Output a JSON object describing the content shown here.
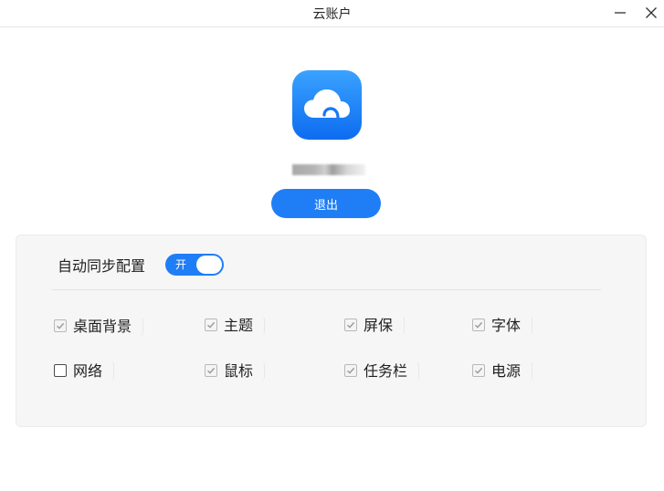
{
  "window": {
    "title": "云账户",
    "minimize_icon": "minimize-icon",
    "close_icon": "close-icon"
  },
  "account": {
    "app_icon": "cloud-icon",
    "name": "",
    "logout_label": "退出"
  },
  "sync": {
    "label": "自动同步配置",
    "toggle_text": "开",
    "enabled": true,
    "accent_color": "#1f7ef6"
  },
  "options": [
    {
      "label": "桌面背景",
      "checked": true
    },
    {
      "label": "主题",
      "checked": true
    },
    {
      "label": "屏保",
      "checked": true
    },
    {
      "label": "字体",
      "checked": true
    },
    {
      "label": "网络",
      "checked": false
    },
    {
      "label": "鼠标",
      "checked": true
    },
    {
      "label": "任务栏",
      "checked": true
    },
    {
      "label": "电源",
      "checked": true
    }
  ]
}
